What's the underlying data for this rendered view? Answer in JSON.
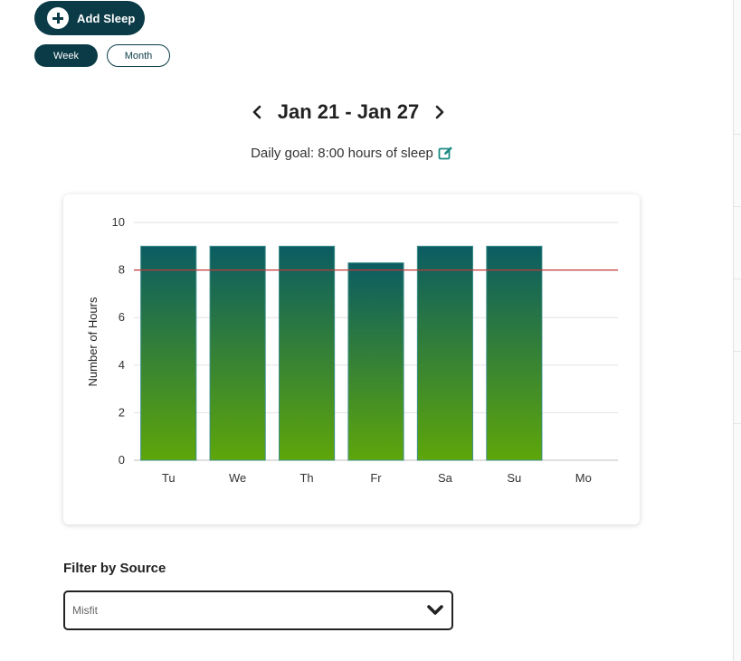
{
  "actions": {
    "add_sleep_label": "Add Sleep"
  },
  "view_toggle": {
    "week_label": "Week",
    "month_label": "Month",
    "selected": "Week"
  },
  "date_nav": {
    "range": "Jan 21 - Jan 27"
  },
  "goal": {
    "text": "Daily goal: 8:00 hours of sleep"
  },
  "filter": {
    "label": "Filter by Source",
    "selected": "Misfit"
  },
  "colors": {
    "brand_dark": "#0b3b47",
    "bar_top": "#0b5c63",
    "bar_bottom": "#5ea60a",
    "goal_line": "#c0393b"
  },
  "chart_data": {
    "type": "bar",
    "categories": [
      "Tu",
      "We",
      "Th",
      "Fr",
      "Sa",
      "Su",
      "Mo"
    ],
    "values": [
      9,
      9,
      9,
      8.3,
      9,
      9,
      null
    ],
    "ylabel": "Number of Hours",
    "xlabel": "",
    "ylim": [
      0,
      10
    ],
    "yticks": [
      0,
      2,
      4,
      6,
      8,
      10
    ],
    "goal_line": 8,
    "grid": true
  }
}
